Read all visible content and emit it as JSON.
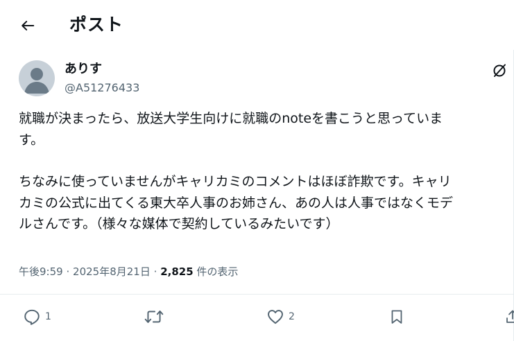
{
  "header": {
    "title": "ポスト"
  },
  "author": {
    "display_name": "ありす",
    "handle": "@A51276433"
  },
  "post": {
    "paragraph1": [
      "就職が決まったら、放送大学生向けに就職のnoteを書こうと思っていま",
      "す。"
    ],
    "paragraph2": [
      "ちなみに使っていませんがキャリカミのコメントはほぼ詐欺です。キャリ",
      "カミの公式に出てくる東大卒人事のお姉さん、あの人は人事ではなくモデ",
      "ルさんです。（様々な媒体で契約しているみたいです）"
    ]
  },
  "meta": {
    "time": "午後9:59",
    "separator": "·",
    "date": "2025年8月21日",
    "views": "2,825",
    "views_suffix": "件の表示"
  },
  "actions": {
    "reply_count": "1",
    "repost_count": "",
    "like_count": "2"
  },
  "colors": {
    "text": "#0f1419",
    "secondary": "#536471",
    "divider": "#e6ecef",
    "avatar": "#c7d0d8"
  },
  "icons": [
    "back-arrow-icon",
    "grok-icon",
    "reply-icon",
    "repost-icon",
    "like-icon",
    "bookmark-icon",
    "share-icon"
  ]
}
